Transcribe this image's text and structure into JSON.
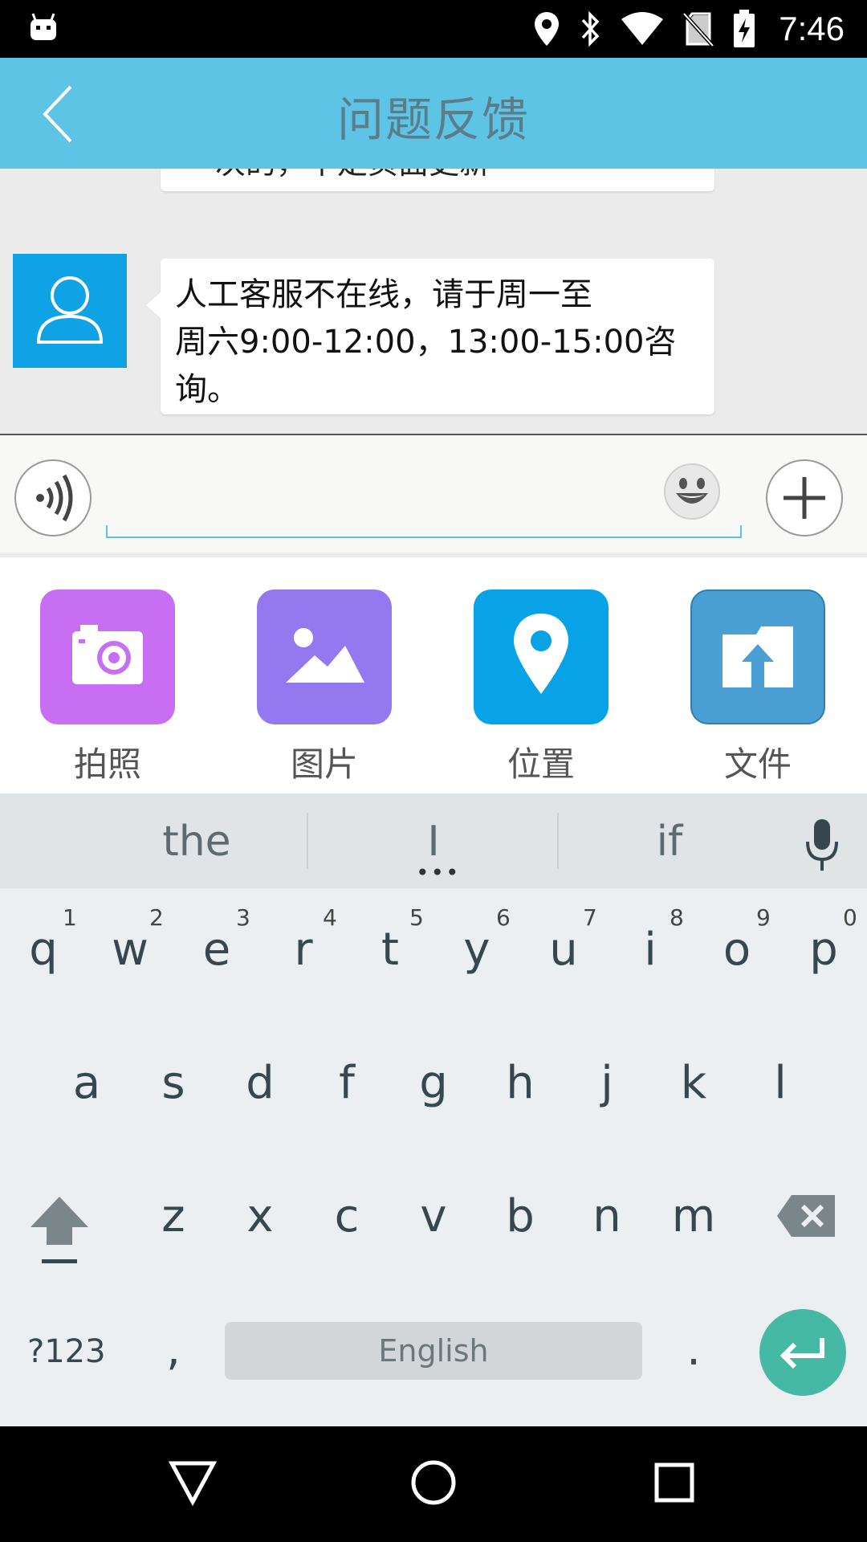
{
  "status_bar": {
    "time": "7:46",
    "icons": [
      "android-debug-icon",
      "location-icon",
      "bluetooth-icon",
      "wifi-icon",
      "no-sim-icon",
      "battery-charging-icon"
    ]
  },
  "header": {
    "title": "问题反馈",
    "back_icon": "back-arrow-icon"
  },
  "chat": {
    "previous_message_fragment": "一次的，不定页面更新",
    "messages": [
      {
        "sender_avatar": "user-icon",
        "text": "人工客服不在线，请于周一至周六9:00-12:00，13:00-15:00咨询。",
        "lines": [
          "人工客服不在线，请于周一至",
          "周六9:00-12:00，13:00-15:00咨",
          "询。"
        ]
      }
    ]
  },
  "input_bar": {
    "value": "",
    "voice_icon": "voice-icon",
    "emoji_icon": "emoji-icon",
    "plus_icon": "plus-icon"
  },
  "attachments": [
    {
      "label": "拍照",
      "icon": "camera-icon",
      "color": "#c86ef2"
    },
    {
      "label": "图片",
      "icon": "image-icon",
      "color": "#9378f0"
    },
    {
      "label": "位置",
      "icon": "location-pin-icon",
      "color": "#07a3e6"
    },
    {
      "label": "文件",
      "icon": "file-upload-icon",
      "color": "#4a9fd4"
    }
  ],
  "keyboard": {
    "suggestions": [
      "the",
      "I",
      "if"
    ],
    "row1": [
      "q",
      "w",
      "e",
      "r",
      "t",
      "y",
      "u",
      "i",
      "o",
      "p"
    ],
    "row1_hints": [
      "1",
      "2",
      "3",
      "4",
      "5",
      "6",
      "7",
      "8",
      "9",
      "0"
    ],
    "row2": [
      "a",
      "s",
      "d",
      "f",
      "g",
      "h",
      "j",
      "k",
      "l"
    ],
    "row3": [
      "z",
      "x",
      "c",
      "v",
      "b",
      "n",
      "m"
    ],
    "symbols_label": "?123",
    "comma": ",",
    "space_label": "English",
    "period": ".",
    "enter_color": "#45b9a4"
  }
}
